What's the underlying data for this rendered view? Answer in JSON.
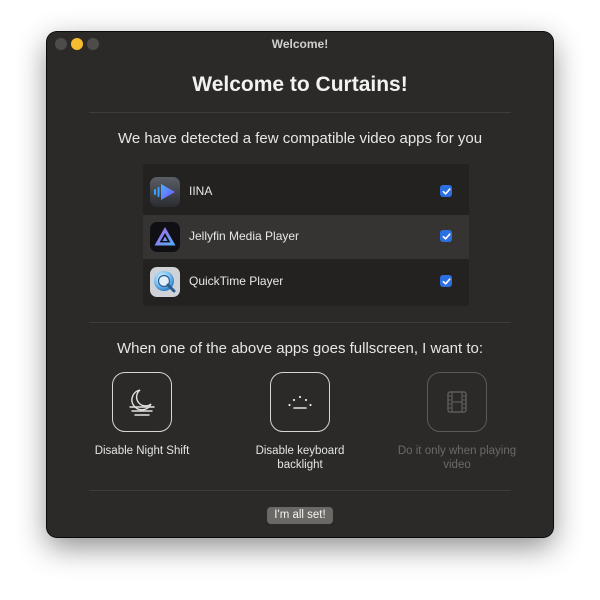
{
  "window": {
    "title": "Welcome!"
  },
  "heading": "Welcome to Curtains!",
  "detected_text": "We have detected a few compatible video apps for you",
  "apps": [
    {
      "name": "IINA",
      "icon": "iina-app-icon",
      "checked": true
    },
    {
      "name": "Jellyfin Media Player",
      "icon": "jellyfin-app-icon",
      "checked": true
    },
    {
      "name": "QuickTime Player",
      "icon": "quicktime-app-icon",
      "checked": true
    }
  ],
  "prompt": "When one of the above apps goes fullscreen, I want to:",
  "options": [
    {
      "label": "Disable Night Shift",
      "icon": "night-shift-icon",
      "enabled": true
    },
    {
      "label": "Disable keyboard backlight",
      "icon": "keyboard-backlight-icon",
      "enabled": true
    },
    {
      "label": "Do it only when playing video",
      "icon": "film-icon",
      "enabled": false
    }
  ],
  "done_label": "I'm all set!",
  "colors": {
    "accent": "#2c6fe0",
    "window_bg": "#2b2a28",
    "list_bg": "#232220"
  }
}
